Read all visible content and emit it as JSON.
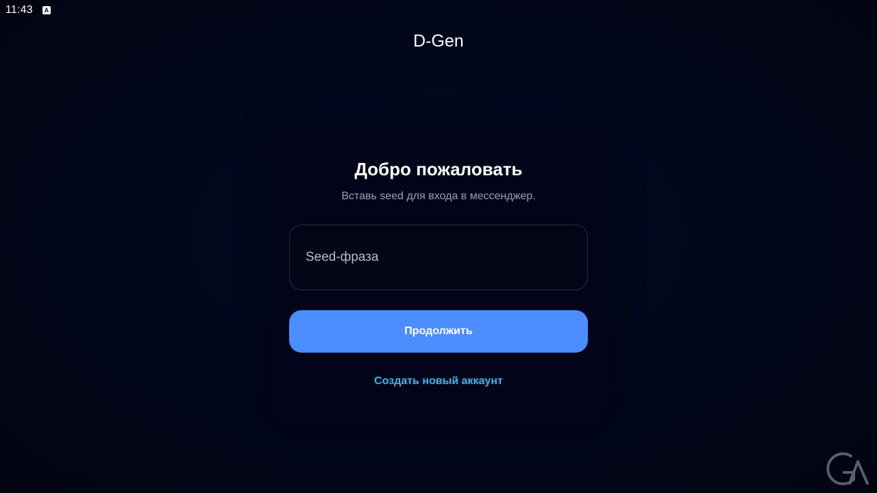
{
  "status_bar": {
    "time": "11:43",
    "notification_icon": "a-icon"
  },
  "app": {
    "title": "D-Gen"
  },
  "login_card": {
    "title": "Добро пожаловать",
    "subtitle": "Вставь seed для входа в мессенджер.",
    "seed_input": {
      "value": "",
      "placeholder": "Seed-фраза"
    },
    "continue_label": "Продолжить",
    "create_account_label": "Создать новый аккаунт"
  },
  "colors": {
    "background": "#02061a",
    "card": "#02051a",
    "primary_button": "#4c8dff",
    "link": "#3ab7ef",
    "subtitle": "#9aa1b3"
  },
  "watermark_icon": "ga-logo-icon"
}
